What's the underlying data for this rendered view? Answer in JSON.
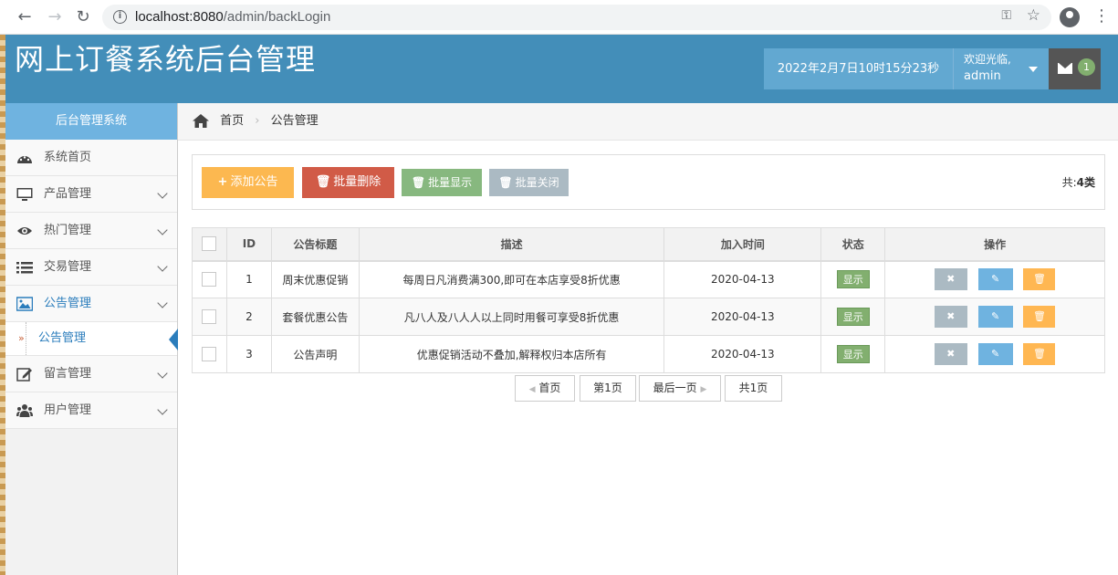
{
  "browser": {
    "url_host": "localhost:8080",
    "url_path": "/admin/backLogin"
  },
  "header": {
    "title": "网上订餐系统后台管理",
    "datetime": "2022年2月7日10时15分23秒",
    "welcome": "欢迎光临,",
    "username": "admin",
    "message_count": "1"
  },
  "sidebar": {
    "head": "后台管理系统",
    "items": [
      {
        "label": "系统首页",
        "icon": "dashboard-icon"
      },
      {
        "label": "产品管理",
        "icon": "desktop-icon"
      },
      {
        "label": "热门管理",
        "icon": "eye-icon"
      },
      {
        "label": "交易管理",
        "icon": "list-icon"
      },
      {
        "label": "公告管理",
        "icon": "picture-icon"
      },
      {
        "label": "留言管理",
        "icon": "edit-icon"
      },
      {
        "label": "用户管理",
        "icon": "users-icon"
      }
    ],
    "sub_item": "公告管理"
  },
  "breadcrumb": {
    "home": "首页",
    "current": "公告管理"
  },
  "toolbar": {
    "add": "添加公告",
    "batch_delete": "批量删除",
    "batch_show": "批量显示",
    "batch_close": "批量关闭",
    "total_label": "共:",
    "total_value": "4类"
  },
  "table": {
    "headers": [
      "ID",
      "公告标题",
      "描述",
      "加入时间",
      "状态",
      "操作"
    ],
    "rows": [
      {
        "id": "1",
        "title": "周末优惠促销",
        "desc": "每周日凡消费满300,即可在本店享受8折优惠",
        "time": "2020-04-13",
        "status": "显示"
      },
      {
        "id": "2",
        "title": "套餐优惠公告",
        "desc": "凡八人及八人人以上同时用餐可享受8折优惠",
        "time": "2020-04-13",
        "status": "显示"
      },
      {
        "id": "3",
        "title": "公告声明",
        "desc": "优惠促销活动不叠加,解释权归本店所有",
        "time": "2020-04-13",
        "status": "显示"
      }
    ]
  },
  "pager": {
    "first": "首页",
    "page": "第1页",
    "last": "最后一页",
    "total": "共1页"
  },
  "colors": {
    "header_bg": "#438eb9",
    "sidebar_head": "#6fb3e0",
    "add": "#fcb850",
    "delete": "#d15b47",
    "show": "#87b87f",
    "close": "#abbac3"
  }
}
